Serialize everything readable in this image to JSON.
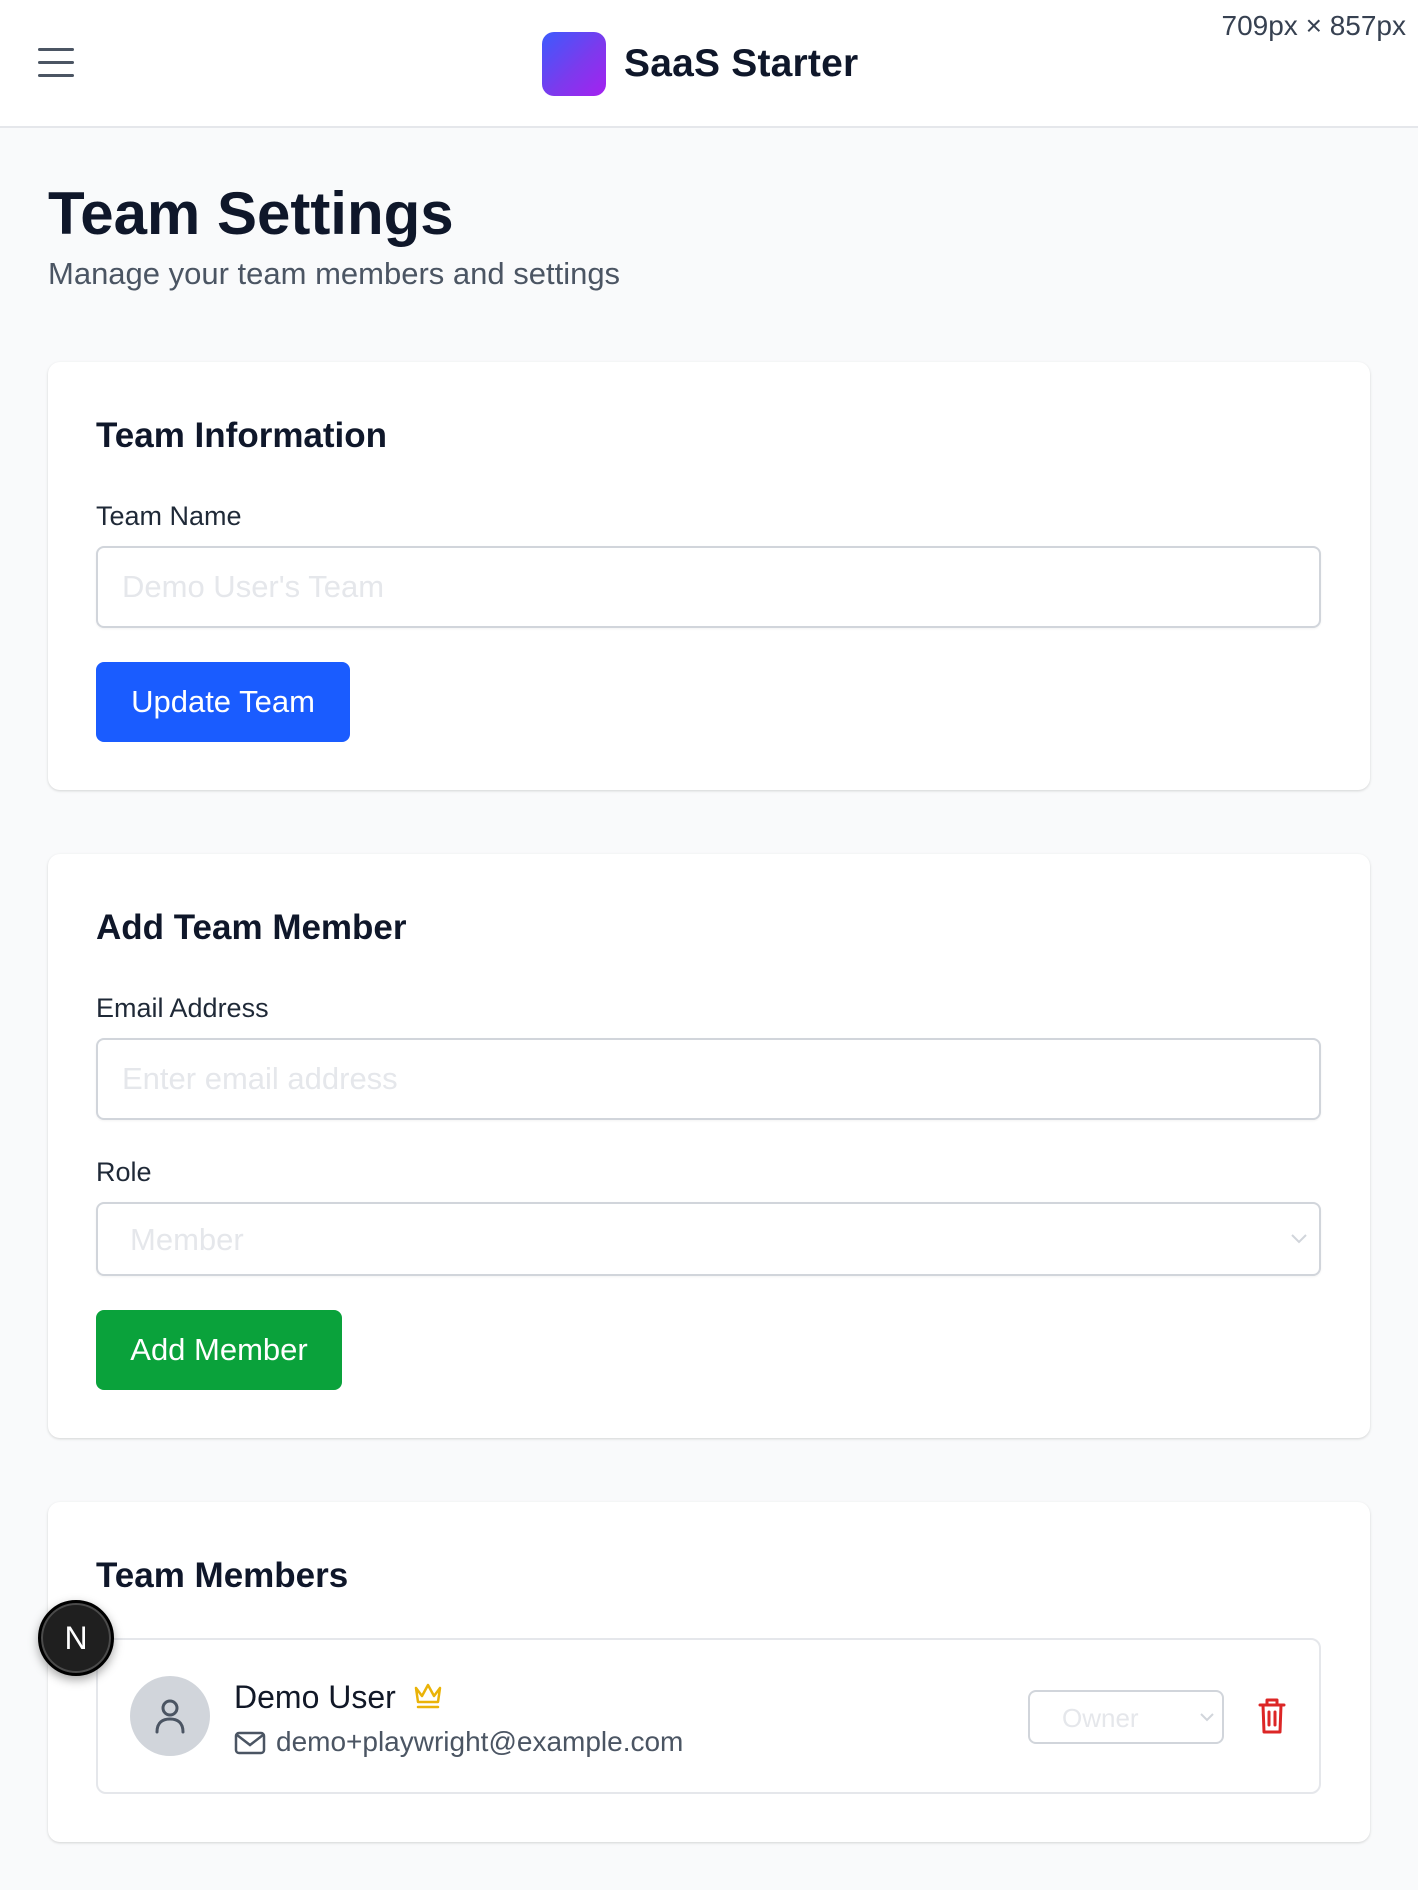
{
  "header": {
    "app_name": "SaaS Starter",
    "viewport_label": "709px × 857px",
    "brand_gradient": [
      "#3b5bfd",
      "#a521f0"
    ]
  },
  "page": {
    "title": "Team Settings",
    "subtitle": "Manage your team members and settings"
  },
  "team_info": {
    "title": "Team Information",
    "name_label": "Team Name",
    "name_placeholder": "Demo User's Team",
    "update_button": "Update Team",
    "button_color": "#1a5cff"
  },
  "add_member": {
    "title": "Add Team Member",
    "email_label": "Email Address",
    "email_placeholder": "Enter email address",
    "role_label": "Role",
    "role_value": "Member",
    "add_button": "Add Member",
    "button_color": "#0aa23b"
  },
  "team_members": {
    "title": "Team Members",
    "members": [
      {
        "name": "Demo User",
        "email": "demo+playwright@example.com",
        "role": "Owner",
        "badge_icon": "crown-icon",
        "avatar_icon": "user-icon"
      }
    ]
  },
  "dev_badge": {
    "label": "N"
  }
}
